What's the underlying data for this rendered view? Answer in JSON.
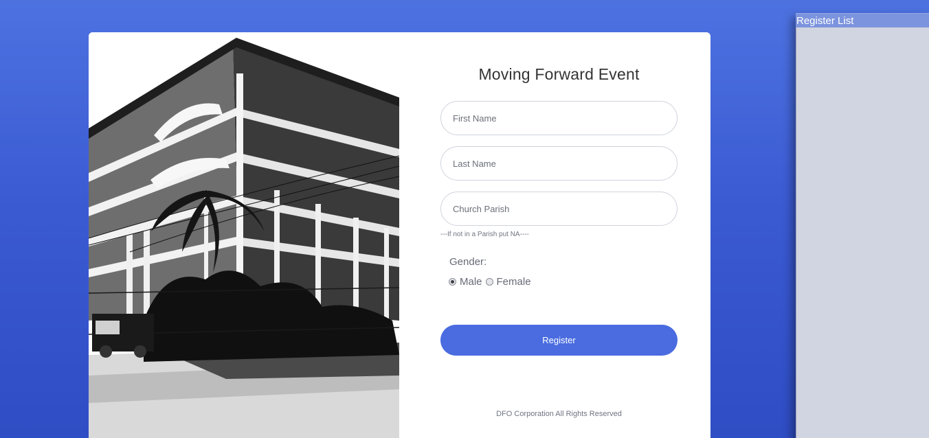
{
  "form": {
    "title": "Moving Forward Event",
    "first_name_placeholder": "First Name",
    "last_name_placeholder": "Last Name",
    "church_parish_placeholder": "Church Parish",
    "parish_hint": "---If not in a Parish put NA----",
    "gender_label": "Gender:",
    "gender_options": [
      "Male",
      "Female"
    ],
    "gender_selected": "Male",
    "register_label": "Register",
    "footer": "DFO Corporation All Rights Reserved"
  },
  "side_panel": {
    "title": "Register List"
  },
  "colors": {
    "background": "#3b5bd3",
    "accent": "#4a6ce0",
    "panel_body": "#d1d5e1"
  }
}
